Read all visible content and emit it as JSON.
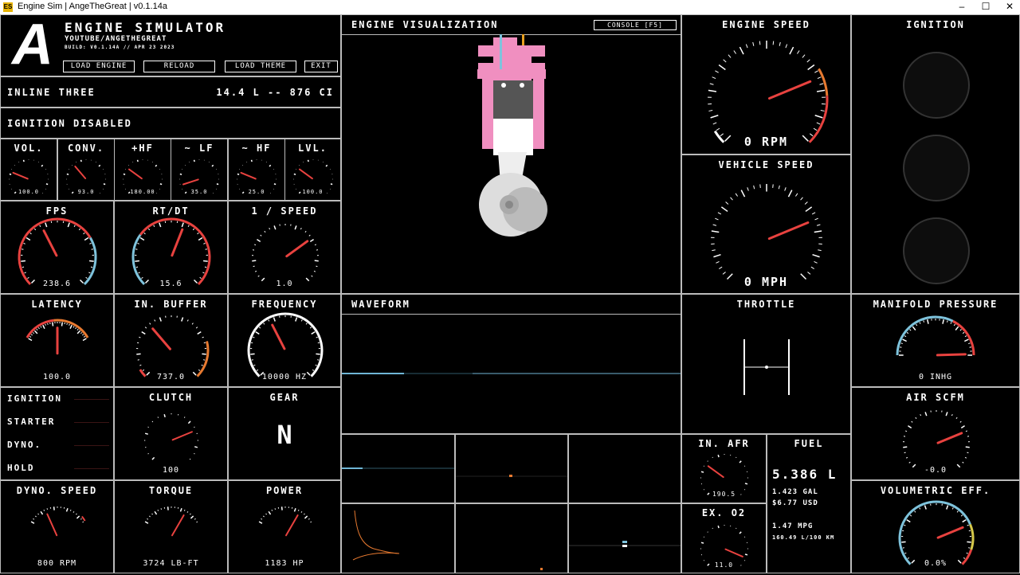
{
  "window": {
    "title": "Engine Sim | AngeTheGreat | v0.1.14a",
    "icon_text": "ES",
    "minimize": "–",
    "maximize": "☐",
    "close": "✕"
  },
  "header": {
    "logo": "A",
    "app_title": "ENGINE SIMULATOR",
    "channel": "YOUTUBE/ANGETHEGREAT",
    "build": "BUILD: V0.1.14A // APR 23 2023",
    "buttons": {
      "load_engine": "LOAD ENGINE",
      "reload": "RELOAD",
      "load_theme": "LOAD THEME",
      "exit": "EXIT"
    }
  },
  "engine": {
    "name": "INLINE THREE",
    "displacement": "14.4 L -- 876 CI",
    "ignition_status": "IGNITION DISABLED"
  },
  "small_gauges": [
    {
      "label": "VOL.",
      "value": "100.0",
      "level": 0.25
    },
    {
      "label": "CONV.",
      "value": "93.0",
      "level": 0.35
    },
    {
      "label": "+HF",
      "value": "180.00",
      "level": 0.3
    },
    {
      "label": "~ LF",
      "value": "35.0",
      "level": 0.1
    },
    {
      "label": "~ HF",
      "value": "25.0",
      "level": 0.25
    },
    {
      "label": "LVL.",
      "value": "100.0",
      "level": 0.3
    }
  ],
  "gauges": {
    "fps": {
      "label": "FPS",
      "value": "238.6",
      "level": 0.4
    },
    "rtdt": {
      "label": "RT/DT",
      "value": "15.6",
      "level": 0.58
    },
    "inv_speed": {
      "label": "1 / SPEED",
      "value": "1.0",
      "level": 0.7
    },
    "latency": {
      "label": "LATENCY",
      "value": "100.0",
      "level": 0.5
    },
    "in_buffer": {
      "label": "IN. BUFFER",
      "value": "737.0",
      "level": 0.35
    },
    "frequency": {
      "label": "FREQUENCY",
      "value": "10000 HZ",
      "level": 0.4
    },
    "clutch": {
      "label": "CLUTCH",
      "value": "100",
      "level": 0.75
    },
    "dyno_speed": {
      "label": "DYNO. SPEED",
      "value": "800 RPM",
      "level": 0.3
    },
    "torque": {
      "label": "TORQUE",
      "value": "3724 LB-FT",
      "level": 0.75
    },
    "power": {
      "label": "POWER",
      "value": "1183 HP",
      "level": 0.75
    },
    "engine_speed": {
      "label": "ENGINE SPEED",
      "value": "0 RPM",
      "level": 0.75
    },
    "vehicle_speed": {
      "label": "VEHICLE SPEED",
      "value": "0 MPH",
      "level": 0.75
    },
    "manifold": {
      "label": "MANIFOLD PRESSURE",
      "value": "0 INHG",
      "level": 0.99
    },
    "air_scfm": {
      "label": "AIR SCFM",
      "value": "-0.0",
      "level": 0.75
    },
    "vol_eff": {
      "label": "VOLUMETRIC EFF.",
      "value": "0.0%",
      "level": 0.75
    },
    "in_afr": {
      "label": "IN. AFR",
      "value": "190.5",
      "level": 0.3
    },
    "ex_o2": {
      "label": "EX. O2",
      "value": "11.0",
      "level": 0.92
    }
  },
  "toggles": {
    "ignition": "IGNITION",
    "starter": "STARTER",
    "dyno": "DYNO.",
    "hold": "HOLD"
  },
  "gear": {
    "label": "GEAR",
    "value": "N"
  },
  "visualization": {
    "title": "ENGINE VISUALIZATION",
    "console_button": "CONSOLE [F5]"
  },
  "waveform": {
    "title": "WAVEFORM"
  },
  "throttle": {
    "label": "THROTTLE"
  },
  "ignition_panel": {
    "label": "IGNITION"
  },
  "fuel": {
    "label": "FUEL",
    "liters": "5.386 L",
    "gallons": "1.423 GAL",
    "usd": "$6.77 USD",
    "mpg": "1.47 MPG",
    "l100km": "160.49 L/100 KM"
  },
  "colors": {
    "red": "#e8423f",
    "blue": "#7ec3dc",
    "orange": "#e87a30",
    "yellow": "#d6c94a",
    "pink": "#f08fc0",
    "waveform": "#6fb6d6"
  }
}
